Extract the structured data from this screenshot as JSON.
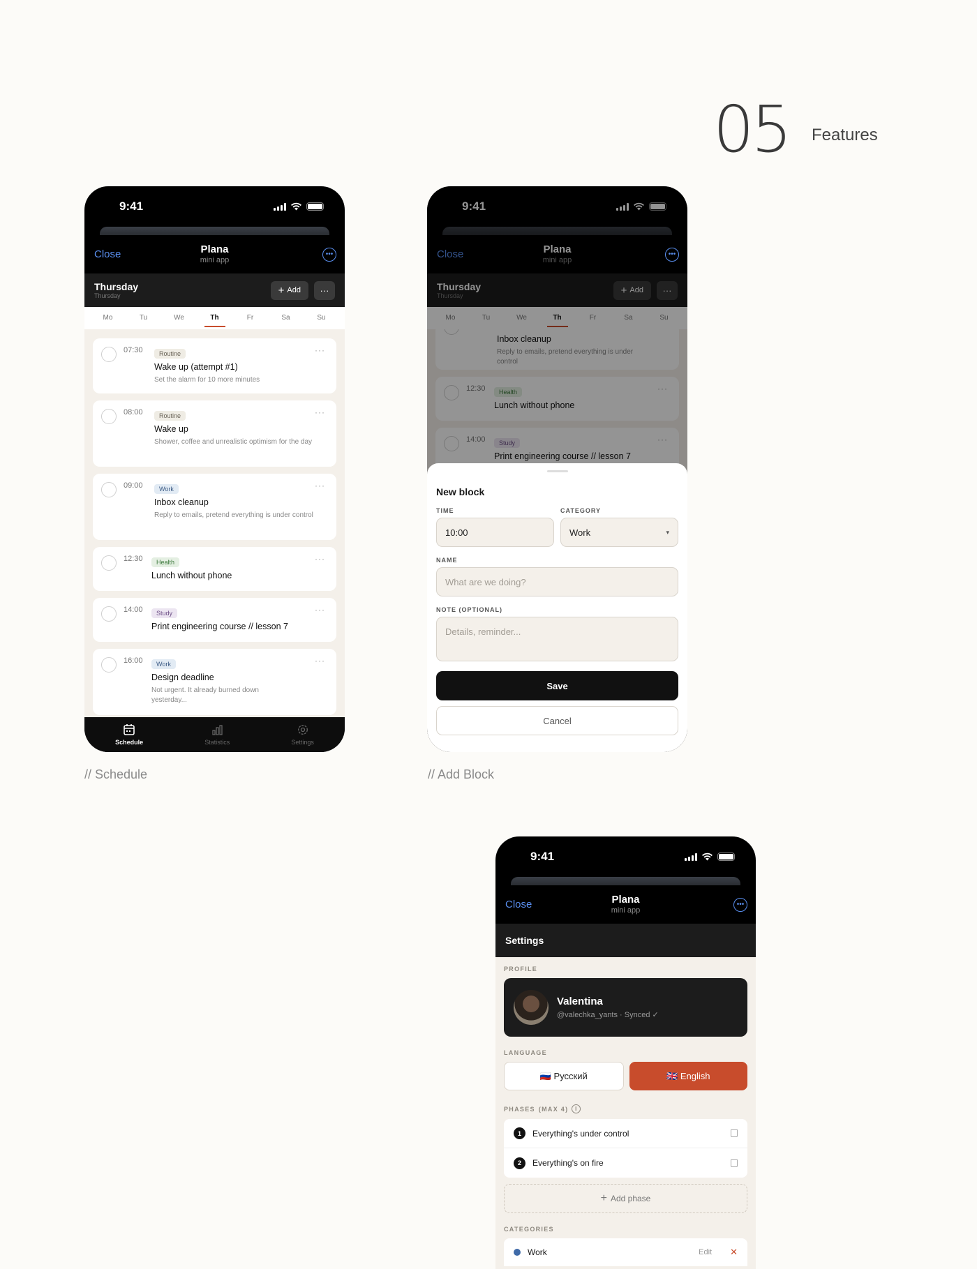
{
  "section": {
    "number": "05",
    "label": "Features"
  },
  "status": {
    "time": "9:41"
  },
  "header": {
    "close": "Close",
    "title": "Plana",
    "subtitle": "mini app",
    "more_glyph": "•••"
  },
  "daybar": {
    "day": "Thursday",
    "subday": "Thursday",
    "add": "Add",
    "plus": "+",
    "dots": "···"
  },
  "week": [
    "Mo",
    "Tu",
    "We",
    "Th",
    "Fr",
    "Sa",
    "Su"
  ],
  "schedule": {
    "caption": "// Schedule",
    "cards": [
      {
        "time": "07:30",
        "tag": "Routine",
        "name": "Wake up (attempt #1)",
        "note": "Set the alarm for 10 more minutes"
      },
      {
        "time": "08:00",
        "tag": "Routine",
        "name": "Wake up",
        "note": "Shower, coffee and unrealistic optimism for the day"
      },
      {
        "time": "09:00",
        "tag": "Work",
        "name": "Inbox cleanup",
        "note": "Reply to emails, pretend everything is under control"
      },
      {
        "time": "12:30",
        "tag": "Health",
        "name": "Lunch without phone",
        "note": ""
      },
      {
        "time": "14:00",
        "tag": "Study",
        "name": "Print engineering course // lesson 7",
        "note": ""
      },
      {
        "time": "16:00",
        "tag": "Work",
        "name": "Design deadline",
        "note": "Not urgent. It already burned down yesterday..."
      }
    ],
    "tabs": [
      {
        "label": "Schedule",
        "icon": "calendar-icon",
        "active": true
      },
      {
        "label": "Statistics",
        "icon": "bar-chart-icon",
        "active": false
      },
      {
        "label": "Settings",
        "icon": "gear-icon",
        "active": false
      }
    ],
    "card_dots": "···"
  },
  "addblock": {
    "caption": "// Add Block",
    "bg_cards": [
      {
        "time": "",
        "tag": "",
        "name": "Inbox cleanup",
        "note": "Reply to emails, pretend everything is under control"
      },
      {
        "time": "12:30",
        "tag": "Health",
        "name": "Lunch without phone",
        "note": ""
      },
      {
        "time": "14:00",
        "tag": "Study",
        "name": "Print engineering course // lesson 7",
        "note": ""
      }
    ],
    "sheet": {
      "title": "New block",
      "time_label": "TIME",
      "time_value": "10:00",
      "category_label": "CATEGORY",
      "category_value": "Work",
      "caret": "▾",
      "name_label": "NAME",
      "name_placeholder": "What are we doing?",
      "note_label": "NOTE (OPTIONAL)",
      "note_placeholder": "Details, reminder...",
      "save": "Save",
      "cancel": "Cancel"
    }
  },
  "settings": {
    "title": "Settings",
    "profile_label": "PROFILE",
    "profile_name": "Valentina",
    "profile_sub": "@valechka_yants · Synced ✓",
    "language_label": "LANGUAGE",
    "lang_ru": "🇷🇺 Русский",
    "lang_en": "🇬🇧 English",
    "phases_label": "PHASES",
    "phases_max": "(MAX 4)",
    "info_glyph": "i",
    "phases": [
      {
        "num": "1",
        "text": "Everything's under control"
      },
      {
        "num": "2",
        "text": "Everything's on fire"
      }
    ],
    "add_phase": "Add phase",
    "add_plus": "+",
    "categories_label": "CATEGORIES",
    "category": {
      "name": "Work",
      "color": "#3f6aa8",
      "edit": "Edit",
      "remove": "✕"
    }
  },
  "colors": {
    "accent": "#c84c2c",
    "link": "#5a8ff0",
    "dark": "#1c1c1c",
    "bg": "#f4f0ea"
  }
}
